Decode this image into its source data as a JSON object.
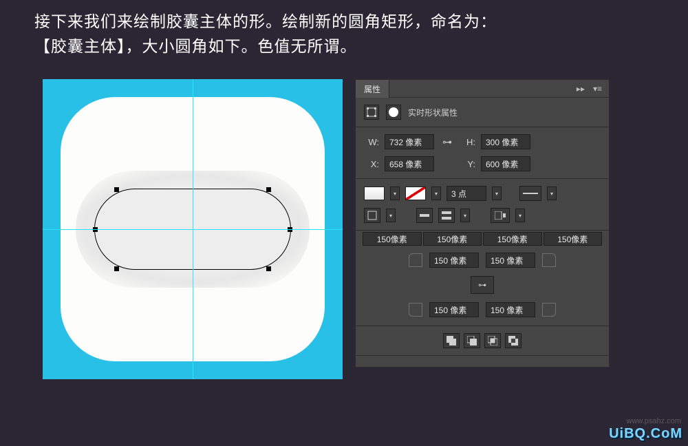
{
  "instruction": {
    "line1": "接下来我们来绘制胶囊主体的形。绘制新的圆角矩形，命名为：",
    "line2": "【胶囊主体】，大小圆角如下。色值无所谓。"
  },
  "panel": {
    "tab": "属性",
    "title": "实时形状属性",
    "width_label": "W:",
    "height_label": "H:",
    "x_label": "X:",
    "y_label": "Y:",
    "w_value": "732 像素",
    "h_value": "300 像素",
    "x_value": "658 像素",
    "y_value": "600 像素",
    "stroke_weight": "3 点",
    "corner_summary": [
      "150像素",
      "150像素",
      "150像素",
      "150像素"
    ],
    "corners": {
      "tl": "150 像素",
      "tr": "150 像素",
      "bl": "150 像素",
      "br": "150 像素"
    }
  },
  "watermark": "UiBQ.CoM",
  "watermark2": "www.psahz.com"
}
